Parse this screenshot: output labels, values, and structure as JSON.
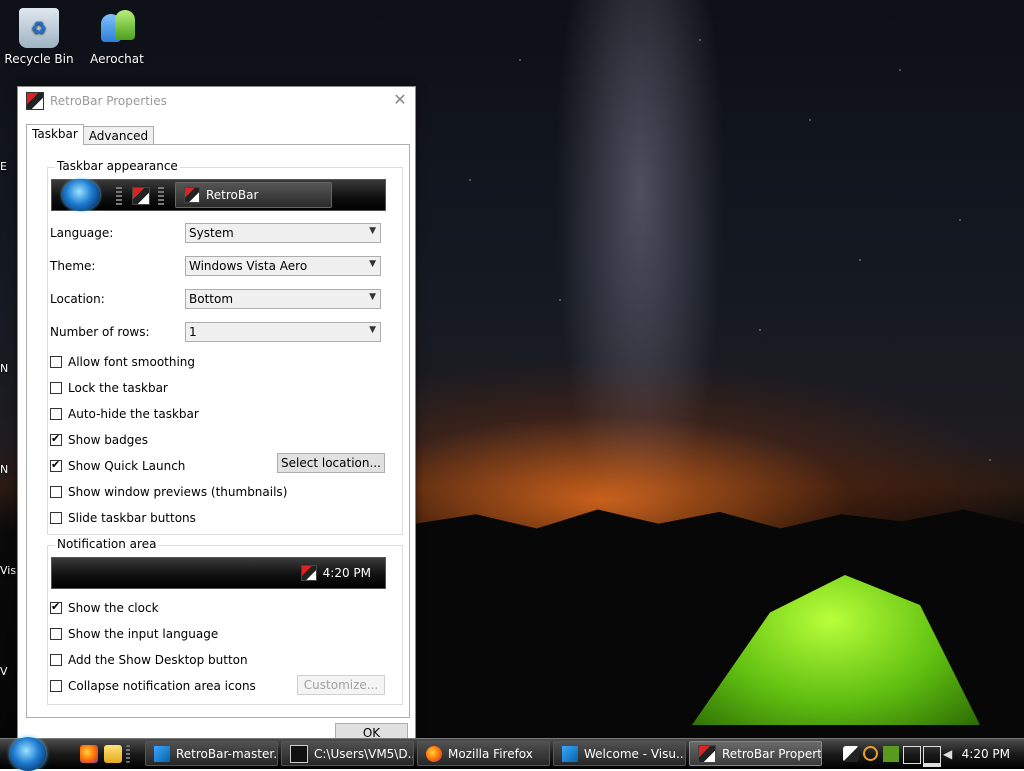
{
  "desktop": {
    "icons": [
      {
        "label": "Recycle Bin"
      },
      {
        "label": "Aerochat"
      }
    ],
    "edge_fragments": [
      "E",
      "N",
      "N",
      "Vis",
      "V"
    ]
  },
  "dialog": {
    "title": "RetroBar Properties",
    "close_glyph": "✕",
    "tabs": [
      {
        "label": "Taskbar"
      },
      {
        "label": "Advanced"
      }
    ],
    "taskbar_appearance": {
      "group_title": "Taskbar appearance",
      "preview_button_label": "RetroBar",
      "language": {
        "label": "Language:",
        "value": "System"
      },
      "theme": {
        "label": "Theme:",
        "value": "Windows Vista Aero"
      },
      "location": {
        "label": "Location:",
        "value": "Bottom"
      },
      "rows": {
        "label": "Number of rows:",
        "value": "1"
      },
      "checkboxes": [
        {
          "label": "Allow font smoothing",
          "checked": false
        },
        {
          "label": "Lock the taskbar",
          "checked": false
        },
        {
          "label": "Auto-hide the taskbar",
          "checked": false
        },
        {
          "label": "Show badges",
          "checked": true
        },
        {
          "label": "Show Quick Launch",
          "checked": true
        },
        {
          "label": "Show window previews (thumbnails)",
          "checked": false
        },
        {
          "label": "Slide taskbar buttons",
          "checked": false
        }
      ],
      "select_location_button": "Select location..."
    },
    "notification_area": {
      "group_title": "Notification area",
      "preview_clock": "4:20 PM",
      "checkboxes": [
        {
          "label": "Show the clock",
          "checked": true
        },
        {
          "label": "Show the input language",
          "checked": false
        },
        {
          "label": "Add the Show Desktop button",
          "checked": false
        },
        {
          "label": "Collapse notification area icons",
          "checked": false
        }
      ],
      "customize_button": "Customize..."
    },
    "ok_button": "OK"
  },
  "taskbar": {
    "buttons": [
      {
        "label": "RetroBar-master...",
        "icon": "vscode-icon"
      },
      {
        "label": "C:\\Users\\VM5\\D...",
        "icon": "7zip-icon"
      },
      {
        "label": "Mozilla Firefox",
        "icon": "firefox-icon"
      },
      {
        "label": "Welcome - Visu...",
        "icon": "vscode-icon"
      },
      {
        "label": "RetroBar Propert...",
        "icon": "retrobar-icon"
      }
    ],
    "clock": "4:20 PM",
    "colors": {
      "vista_blue": "#1d7bd1",
      "tent_green": "#7ddc1c"
    }
  }
}
